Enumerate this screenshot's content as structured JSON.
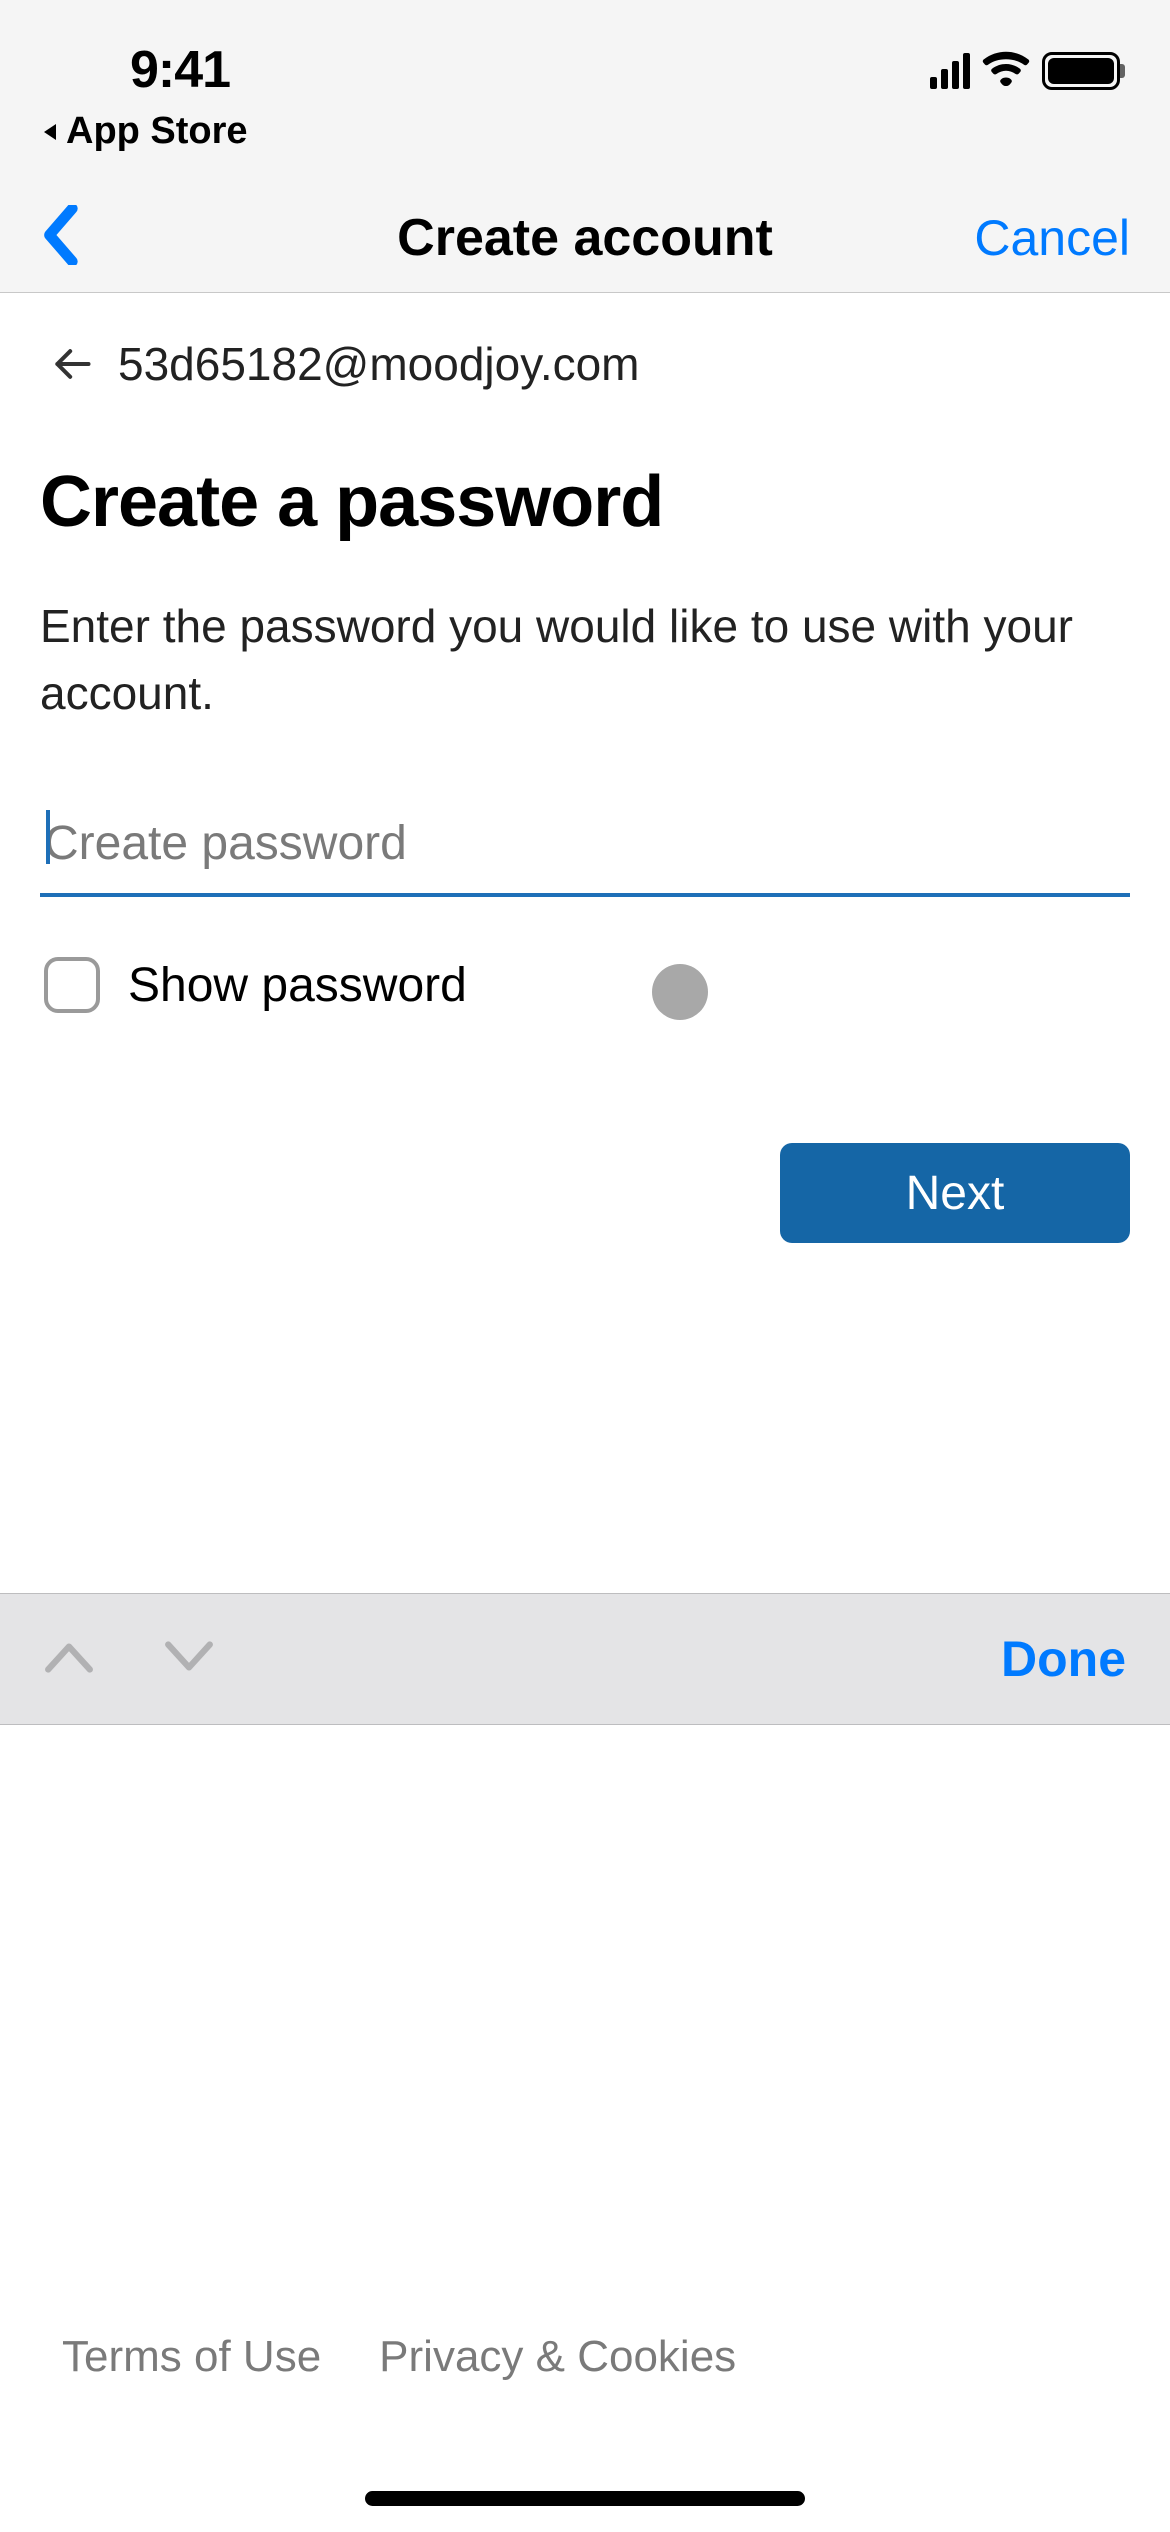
{
  "status": {
    "time": "9:41"
  },
  "app_back": {
    "label": "App Store"
  },
  "nav": {
    "title": "Create account",
    "cancel": "Cancel"
  },
  "email_row": {
    "email": "53d65182@moodjoy.com"
  },
  "page": {
    "heading": "Create a password",
    "subheading": "Enter the password you would like to use with your account."
  },
  "password": {
    "placeholder": "Create password",
    "value": ""
  },
  "show_password": {
    "label": "Show password",
    "checked": false
  },
  "buttons": {
    "next": "Next"
  },
  "keyboard_accessory": {
    "done": "Done"
  },
  "footer": {
    "terms": "Terms of Use",
    "privacy": "Privacy & Cookies"
  }
}
